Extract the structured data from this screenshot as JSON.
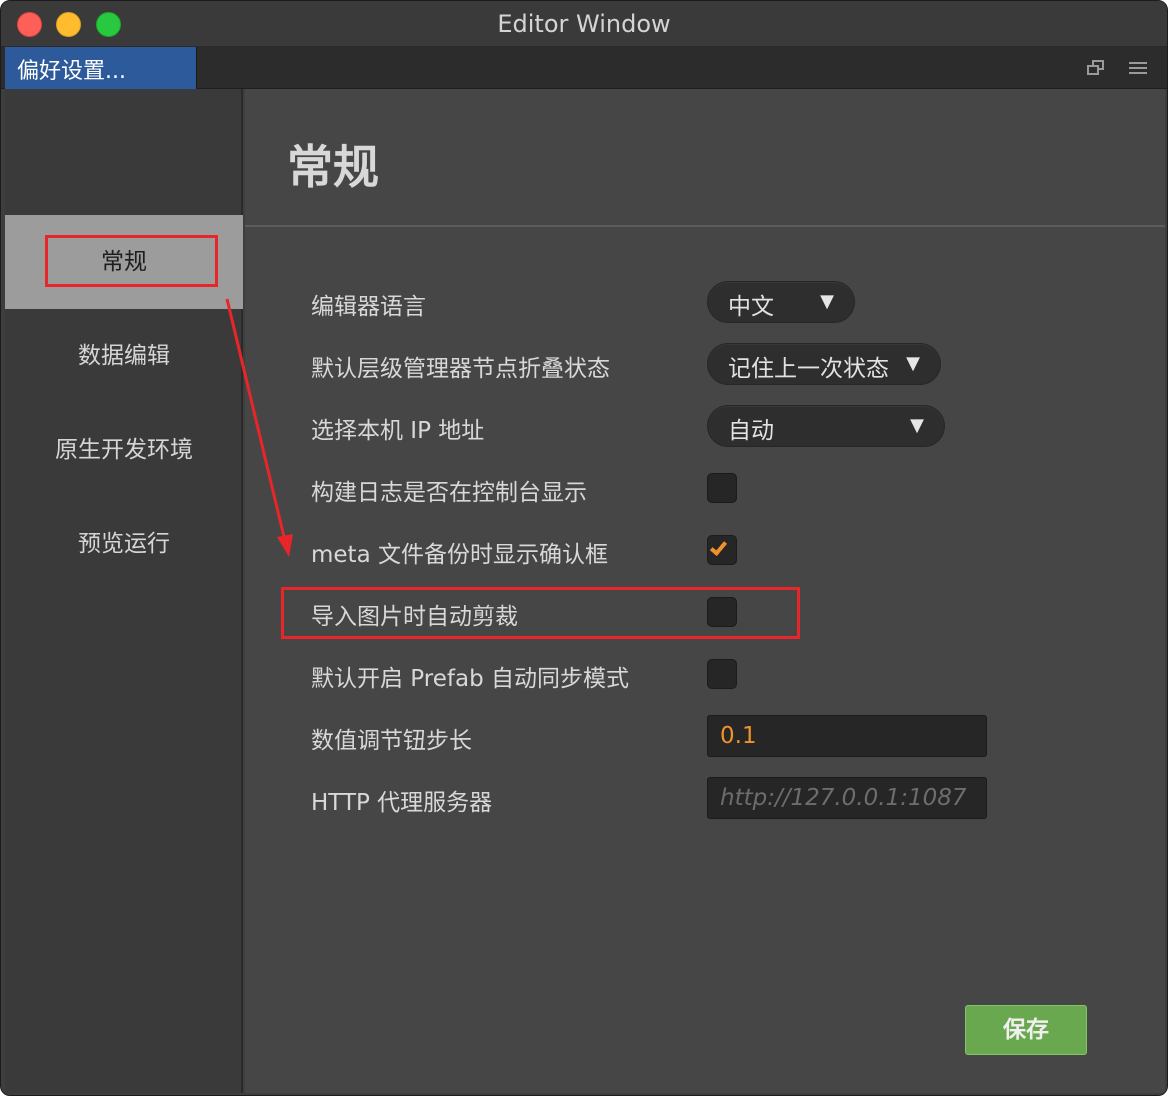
{
  "window": {
    "title": "Editor Window"
  },
  "tabbar": {
    "tab_label": "偏好设置..."
  },
  "sidebar": {
    "items": [
      {
        "label": "常规",
        "active": true
      },
      {
        "label": "数据编辑",
        "active": false
      },
      {
        "label": "原生开发环境",
        "active": false
      },
      {
        "label": "预览运行",
        "active": false
      }
    ]
  },
  "main": {
    "title": "常规",
    "settings": [
      {
        "label": "编辑器语言",
        "type": "select",
        "value": "中文"
      },
      {
        "label": "默认层级管理器节点折叠状态",
        "type": "select",
        "value": "记住上一次状态"
      },
      {
        "label": "选择本机 IP 地址",
        "type": "select",
        "value": "自动"
      },
      {
        "label": "构建日志是否在控制台显示",
        "type": "checkbox",
        "checked": false
      },
      {
        "label": "meta 文件备份时显示确认框",
        "type": "checkbox",
        "checked": true
      },
      {
        "label": "导入图片时自动剪裁",
        "type": "checkbox",
        "checked": false
      },
      {
        "label": "默认开启 Prefab 自动同步模式",
        "type": "checkbox",
        "checked": false
      },
      {
        "label": "数值调节钮步长",
        "type": "number",
        "value": "0.1"
      },
      {
        "label": "HTTP 代理服务器",
        "type": "text",
        "value": "",
        "placeholder": "http://127.0.0.1:1087"
      }
    ],
    "save_label": "保存"
  },
  "colors": {
    "accent_orange": "#f0922a",
    "save_green": "#6aa84f",
    "tab_blue": "#2d5a9a",
    "annotation_red": "#e8262a"
  }
}
